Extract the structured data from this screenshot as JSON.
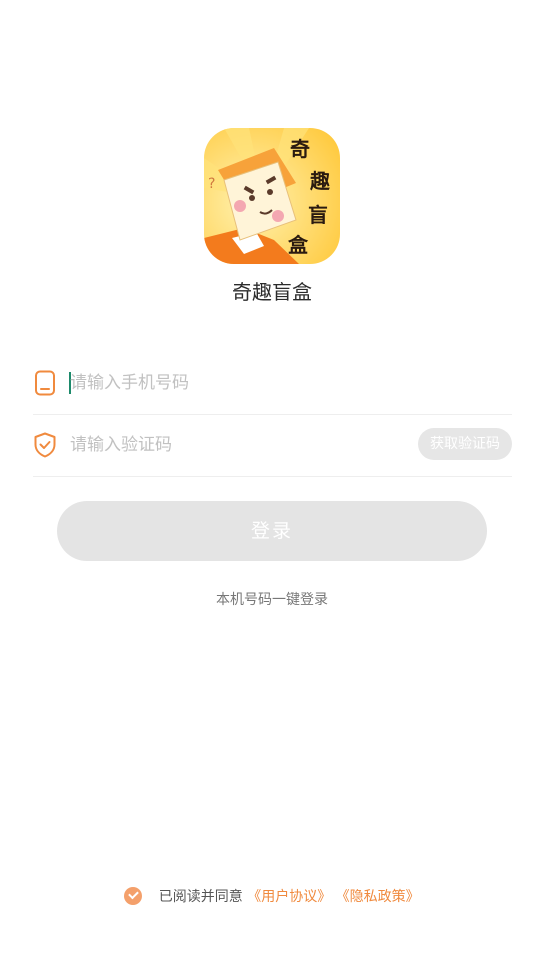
{
  "app": {
    "name": "奇趣盲盒",
    "logo_chars": [
      "奇",
      "趣",
      "盲",
      "盒"
    ]
  },
  "form": {
    "phone_placeholder": "请输入手机号码",
    "code_placeholder": "请输入验证码",
    "get_code_label": "获取验证码",
    "login_label": "登录",
    "one_click_label": "本机号码一键登录"
  },
  "agreement": {
    "prefix": "已阅读并同意",
    "user_agreement": "《用户协议》",
    "privacy_policy": "《隐私政策》"
  },
  "colors": {
    "accent": "#f08a3e",
    "disabled": "#e4e4e4"
  }
}
